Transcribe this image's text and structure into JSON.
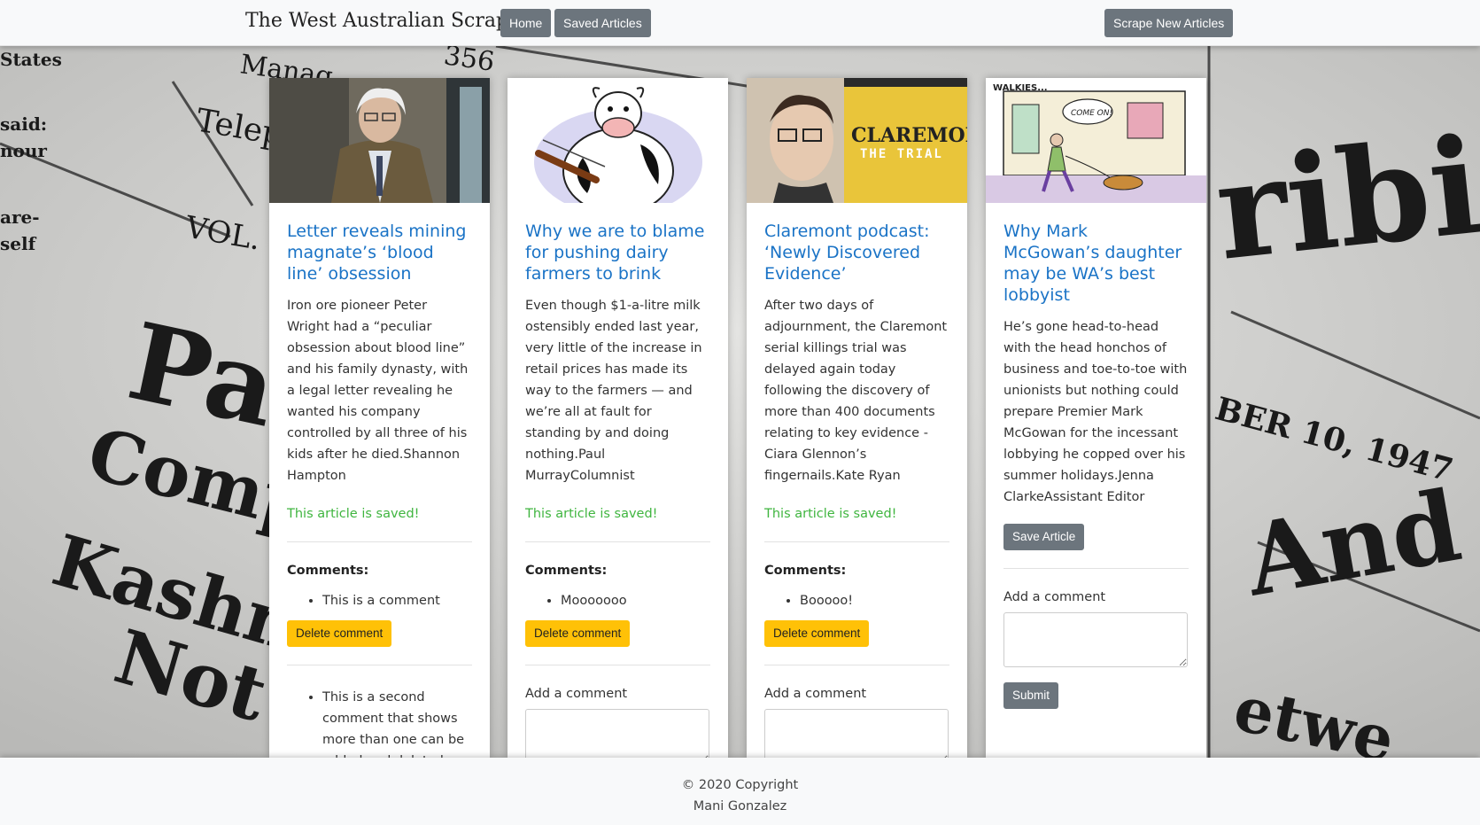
{
  "navbar": {
    "brand": "The West Australian Scraper",
    "home_label": "Home",
    "saved_label": "Saved Articles",
    "scrape_label": "Scrape New Articles"
  },
  "articles": [
    {
      "title": "Letter reveals mining magnate’s ‘blood line’ obsession",
      "summary": "Iron ore pioneer Peter Wright had a “peculiar obsession about blood line” and his family dynasty, with a legal letter revealing he wanted his company controlled by all three of his kids after he died.Shannon Hampton",
      "saved_text": "This article is saved!",
      "comments_heading": "Comments:",
      "comments": [
        "This is a comment",
        "This is a second comment that shows more than one can be added and deleted"
      ],
      "delete_label": "Delete comment"
    },
    {
      "title": "Why we are to blame for pushing dairy farmers to brink",
      "summary": "Even though $1-a-litre milk ostensibly ended last year, very little of the increase in retail prices has made its way to the farmers — and we’re all at fault for standing by and doing nothing.Paul MurrayColumnist",
      "saved_text": "This article is saved!",
      "comments_heading": "Comments:",
      "comments": [
        "Mooooooo"
      ],
      "delete_label": "Delete comment",
      "add_comment_label": "Add a comment"
    },
    {
      "title": "Claremont podcast: ‘Newly Discovered Evidence’",
      "summary": "After two days of adjournment, the Claremont serial killings trial was delayed again today following the discovery of more than 400 documents relating to key evidence - Ciara Glennon’s fingernails.Kate Ryan",
      "saved_text": "This article is saved!",
      "comments_heading": "Comments:",
      "comments": [
        "Booooo!"
      ],
      "delete_label": "Delete comment",
      "add_comment_label": "Add a comment",
      "image_text_1": "CLAREMONT",
      "image_text_2": "THE TRIAL"
    },
    {
      "title": "Why Mark McGowan’s daughter may be WA’s best lobbyist",
      "summary": "He’s gone head-to-head with the head honchos of business and toe-to-toe with unionists but nothing could prepare Premier Mark McGowan for the incessant lobbying he copped over his summer holidays.Jenna ClarkeAssistant Editor",
      "save_label": "Save Article",
      "add_comment_label": "Add a comment",
      "submit_label": "Submit",
      "image_text_1": "WALKIES...",
      "image_text_2": "COME ON!"
    }
  ],
  "background": {
    "words": [
      "Manag",
      "356",
      "Teleph",
      "VOL.",
      "Pa",
      "Comp",
      "Kashn",
      "Not",
      "ribi",
      "BER 10, 1947",
      "And",
      "etwe",
      "States",
      "said:",
      "nour",
      "are-",
      "self"
    ]
  },
  "footer": {
    "line1": "© 2020 Copyright",
    "line2": "Mani Gonzalez"
  }
}
